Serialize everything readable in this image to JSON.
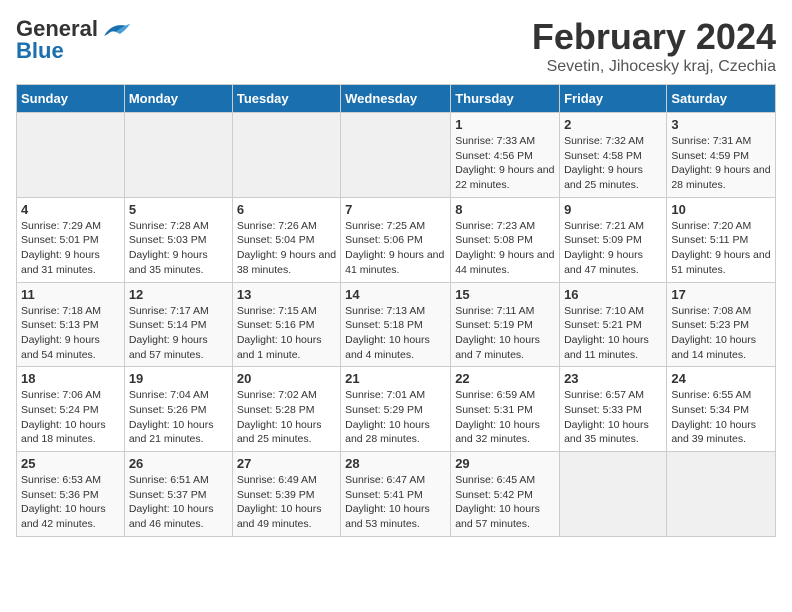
{
  "header": {
    "logo_line1": "General",
    "logo_line2": "Blue",
    "month_year": "February 2024",
    "location": "Sevetin, Jihocesky kraj, Czechia"
  },
  "calendar": {
    "days_of_week": [
      "Sunday",
      "Monday",
      "Tuesday",
      "Wednesday",
      "Thursday",
      "Friday",
      "Saturday"
    ],
    "weeks": [
      [
        {
          "day": "",
          "info": ""
        },
        {
          "day": "",
          "info": ""
        },
        {
          "day": "",
          "info": ""
        },
        {
          "day": "",
          "info": ""
        },
        {
          "day": "1",
          "info": "Sunrise: 7:33 AM\nSunset: 4:56 PM\nDaylight: 9 hours and 22 minutes."
        },
        {
          "day": "2",
          "info": "Sunrise: 7:32 AM\nSunset: 4:58 PM\nDaylight: 9 hours and 25 minutes."
        },
        {
          "day": "3",
          "info": "Sunrise: 7:31 AM\nSunset: 4:59 PM\nDaylight: 9 hours and 28 minutes."
        }
      ],
      [
        {
          "day": "4",
          "info": "Sunrise: 7:29 AM\nSunset: 5:01 PM\nDaylight: 9 hours and 31 minutes."
        },
        {
          "day": "5",
          "info": "Sunrise: 7:28 AM\nSunset: 5:03 PM\nDaylight: 9 hours and 35 minutes."
        },
        {
          "day": "6",
          "info": "Sunrise: 7:26 AM\nSunset: 5:04 PM\nDaylight: 9 hours and 38 minutes."
        },
        {
          "day": "7",
          "info": "Sunrise: 7:25 AM\nSunset: 5:06 PM\nDaylight: 9 hours and 41 minutes."
        },
        {
          "day": "8",
          "info": "Sunrise: 7:23 AM\nSunset: 5:08 PM\nDaylight: 9 hours and 44 minutes."
        },
        {
          "day": "9",
          "info": "Sunrise: 7:21 AM\nSunset: 5:09 PM\nDaylight: 9 hours and 47 minutes."
        },
        {
          "day": "10",
          "info": "Sunrise: 7:20 AM\nSunset: 5:11 PM\nDaylight: 9 hours and 51 minutes."
        }
      ],
      [
        {
          "day": "11",
          "info": "Sunrise: 7:18 AM\nSunset: 5:13 PM\nDaylight: 9 hours and 54 minutes."
        },
        {
          "day": "12",
          "info": "Sunrise: 7:17 AM\nSunset: 5:14 PM\nDaylight: 9 hours and 57 minutes."
        },
        {
          "day": "13",
          "info": "Sunrise: 7:15 AM\nSunset: 5:16 PM\nDaylight: 10 hours and 1 minute."
        },
        {
          "day": "14",
          "info": "Sunrise: 7:13 AM\nSunset: 5:18 PM\nDaylight: 10 hours and 4 minutes."
        },
        {
          "day": "15",
          "info": "Sunrise: 7:11 AM\nSunset: 5:19 PM\nDaylight: 10 hours and 7 minutes."
        },
        {
          "day": "16",
          "info": "Sunrise: 7:10 AM\nSunset: 5:21 PM\nDaylight: 10 hours and 11 minutes."
        },
        {
          "day": "17",
          "info": "Sunrise: 7:08 AM\nSunset: 5:23 PM\nDaylight: 10 hours and 14 minutes."
        }
      ],
      [
        {
          "day": "18",
          "info": "Sunrise: 7:06 AM\nSunset: 5:24 PM\nDaylight: 10 hours and 18 minutes."
        },
        {
          "day": "19",
          "info": "Sunrise: 7:04 AM\nSunset: 5:26 PM\nDaylight: 10 hours and 21 minutes."
        },
        {
          "day": "20",
          "info": "Sunrise: 7:02 AM\nSunset: 5:28 PM\nDaylight: 10 hours and 25 minutes."
        },
        {
          "day": "21",
          "info": "Sunrise: 7:01 AM\nSunset: 5:29 PM\nDaylight: 10 hours and 28 minutes."
        },
        {
          "day": "22",
          "info": "Sunrise: 6:59 AM\nSunset: 5:31 PM\nDaylight: 10 hours and 32 minutes."
        },
        {
          "day": "23",
          "info": "Sunrise: 6:57 AM\nSunset: 5:33 PM\nDaylight: 10 hours and 35 minutes."
        },
        {
          "day": "24",
          "info": "Sunrise: 6:55 AM\nSunset: 5:34 PM\nDaylight: 10 hours and 39 minutes."
        }
      ],
      [
        {
          "day": "25",
          "info": "Sunrise: 6:53 AM\nSunset: 5:36 PM\nDaylight: 10 hours and 42 minutes."
        },
        {
          "day": "26",
          "info": "Sunrise: 6:51 AM\nSunset: 5:37 PM\nDaylight: 10 hours and 46 minutes."
        },
        {
          "day": "27",
          "info": "Sunrise: 6:49 AM\nSunset: 5:39 PM\nDaylight: 10 hours and 49 minutes."
        },
        {
          "day": "28",
          "info": "Sunrise: 6:47 AM\nSunset: 5:41 PM\nDaylight: 10 hours and 53 minutes."
        },
        {
          "day": "29",
          "info": "Sunrise: 6:45 AM\nSunset: 5:42 PM\nDaylight: 10 hours and 57 minutes."
        },
        {
          "day": "",
          "info": ""
        },
        {
          "day": "",
          "info": ""
        }
      ]
    ]
  }
}
